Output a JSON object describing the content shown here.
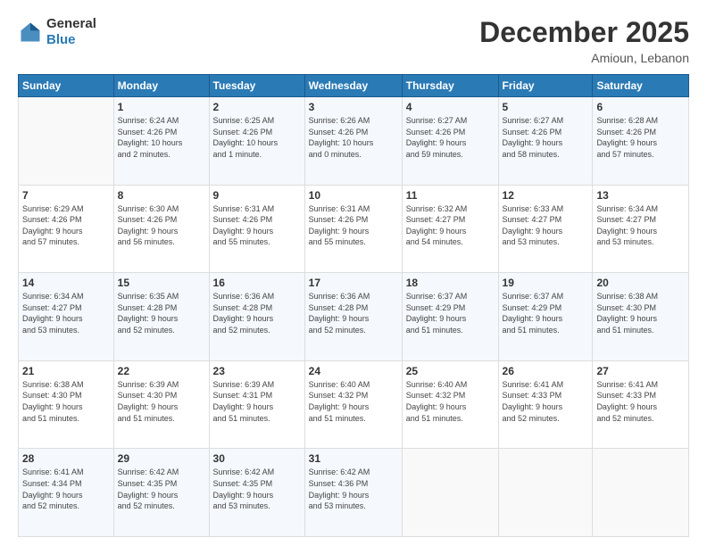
{
  "header": {
    "logo_line1": "General",
    "logo_line2": "Blue",
    "title": "December 2025",
    "subtitle": "Amioun, Lebanon"
  },
  "columns": [
    "Sunday",
    "Monday",
    "Tuesday",
    "Wednesday",
    "Thursday",
    "Friday",
    "Saturday"
  ],
  "weeks": [
    [
      {
        "day": "",
        "info": ""
      },
      {
        "day": "1",
        "info": "Sunrise: 6:24 AM\nSunset: 4:26 PM\nDaylight: 10 hours\nand 2 minutes."
      },
      {
        "day": "2",
        "info": "Sunrise: 6:25 AM\nSunset: 4:26 PM\nDaylight: 10 hours\nand 1 minute."
      },
      {
        "day": "3",
        "info": "Sunrise: 6:26 AM\nSunset: 4:26 PM\nDaylight: 10 hours\nand 0 minutes."
      },
      {
        "day": "4",
        "info": "Sunrise: 6:27 AM\nSunset: 4:26 PM\nDaylight: 9 hours\nand 59 minutes."
      },
      {
        "day": "5",
        "info": "Sunrise: 6:27 AM\nSunset: 4:26 PM\nDaylight: 9 hours\nand 58 minutes."
      },
      {
        "day": "6",
        "info": "Sunrise: 6:28 AM\nSunset: 4:26 PM\nDaylight: 9 hours\nand 57 minutes."
      }
    ],
    [
      {
        "day": "7",
        "info": "Sunrise: 6:29 AM\nSunset: 4:26 PM\nDaylight: 9 hours\nand 57 minutes."
      },
      {
        "day": "8",
        "info": "Sunrise: 6:30 AM\nSunset: 4:26 PM\nDaylight: 9 hours\nand 56 minutes."
      },
      {
        "day": "9",
        "info": "Sunrise: 6:31 AM\nSunset: 4:26 PM\nDaylight: 9 hours\nand 55 minutes."
      },
      {
        "day": "10",
        "info": "Sunrise: 6:31 AM\nSunset: 4:26 PM\nDaylight: 9 hours\nand 55 minutes."
      },
      {
        "day": "11",
        "info": "Sunrise: 6:32 AM\nSunset: 4:27 PM\nDaylight: 9 hours\nand 54 minutes."
      },
      {
        "day": "12",
        "info": "Sunrise: 6:33 AM\nSunset: 4:27 PM\nDaylight: 9 hours\nand 53 minutes."
      },
      {
        "day": "13",
        "info": "Sunrise: 6:34 AM\nSunset: 4:27 PM\nDaylight: 9 hours\nand 53 minutes."
      }
    ],
    [
      {
        "day": "14",
        "info": "Sunrise: 6:34 AM\nSunset: 4:27 PM\nDaylight: 9 hours\nand 53 minutes."
      },
      {
        "day": "15",
        "info": "Sunrise: 6:35 AM\nSunset: 4:28 PM\nDaylight: 9 hours\nand 52 minutes."
      },
      {
        "day": "16",
        "info": "Sunrise: 6:36 AM\nSunset: 4:28 PM\nDaylight: 9 hours\nand 52 minutes."
      },
      {
        "day": "17",
        "info": "Sunrise: 6:36 AM\nSunset: 4:28 PM\nDaylight: 9 hours\nand 52 minutes."
      },
      {
        "day": "18",
        "info": "Sunrise: 6:37 AM\nSunset: 4:29 PM\nDaylight: 9 hours\nand 51 minutes."
      },
      {
        "day": "19",
        "info": "Sunrise: 6:37 AM\nSunset: 4:29 PM\nDaylight: 9 hours\nand 51 minutes."
      },
      {
        "day": "20",
        "info": "Sunrise: 6:38 AM\nSunset: 4:30 PM\nDaylight: 9 hours\nand 51 minutes."
      }
    ],
    [
      {
        "day": "21",
        "info": "Sunrise: 6:38 AM\nSunset: 4:30 PM\nDaylight: 9 hours\nand 51 minutes."
      },
      {
        "day": "22",
        "info": "Sunrise: 6:39 AM\nSunset: 4:30 PM\nDaylight: 9 hours\nand 51 minutes."
      },
      {
        "day": "23",
        "info": "Sunrise: 6:39 AM\nSunset: 4:31 PM\nDaylight: 9 hours\nand 51 minutes."
      },
      {
        "day": "24",
        "info": "Sunrise: 6:40 AM\nSunset: 4:32 PM\nDaylight: 9 hours\nand 51 minutes."
      },
      {
        "day": "25",
        "info": "Sunrise: 6:40 AM\nSunset: 4:32 PM\nDaylight: 9 hours\nand 51 minutes."
      },
      {
        "day": "26",
        "info": "Sunrise: 6:41 AM\nSunset: 4:33 PM\nDaylight: 9 hours\nand 52 minutes."
      },
      {
        "day": "27",
        "info": "Sunrise: 6:41 AM\nSunset: 4:33 PM\nDaylight: 9 hours\nand 52 minutes."
      }
    ],
    [
      {
        "day": "28",
        "info": "Sunrise: 6:41 AM\nSunset: 4:34 PM\nDaylight: 9 hours\nand 52 minutes."
      },
      {
        "day": "29",
        "info": "Sunrise: 6:42 AM\nSunset: 4:35 PM\nDaylight: 9 hours\nand 52 minutes."
      },
      {
        "day": "30",
        "info": "Sunrise: 6:42 AM\nSunset: 4:35 PM\nDaylight: 9 hours\nand 53 minutes."
      },
      {
        "day": "31",
        "info": "Sunrise: 6:42 AM\nSunset: 4:36 PM\nDaylight: 9 hours\nand 53 minutes."
      },
      {
        "day": "",
        "info": ""
      },
      {
        "day": "",
        "info": ""
      },
      {
        "day": "",
        "info": ""
      }
    ]
  ]
}
